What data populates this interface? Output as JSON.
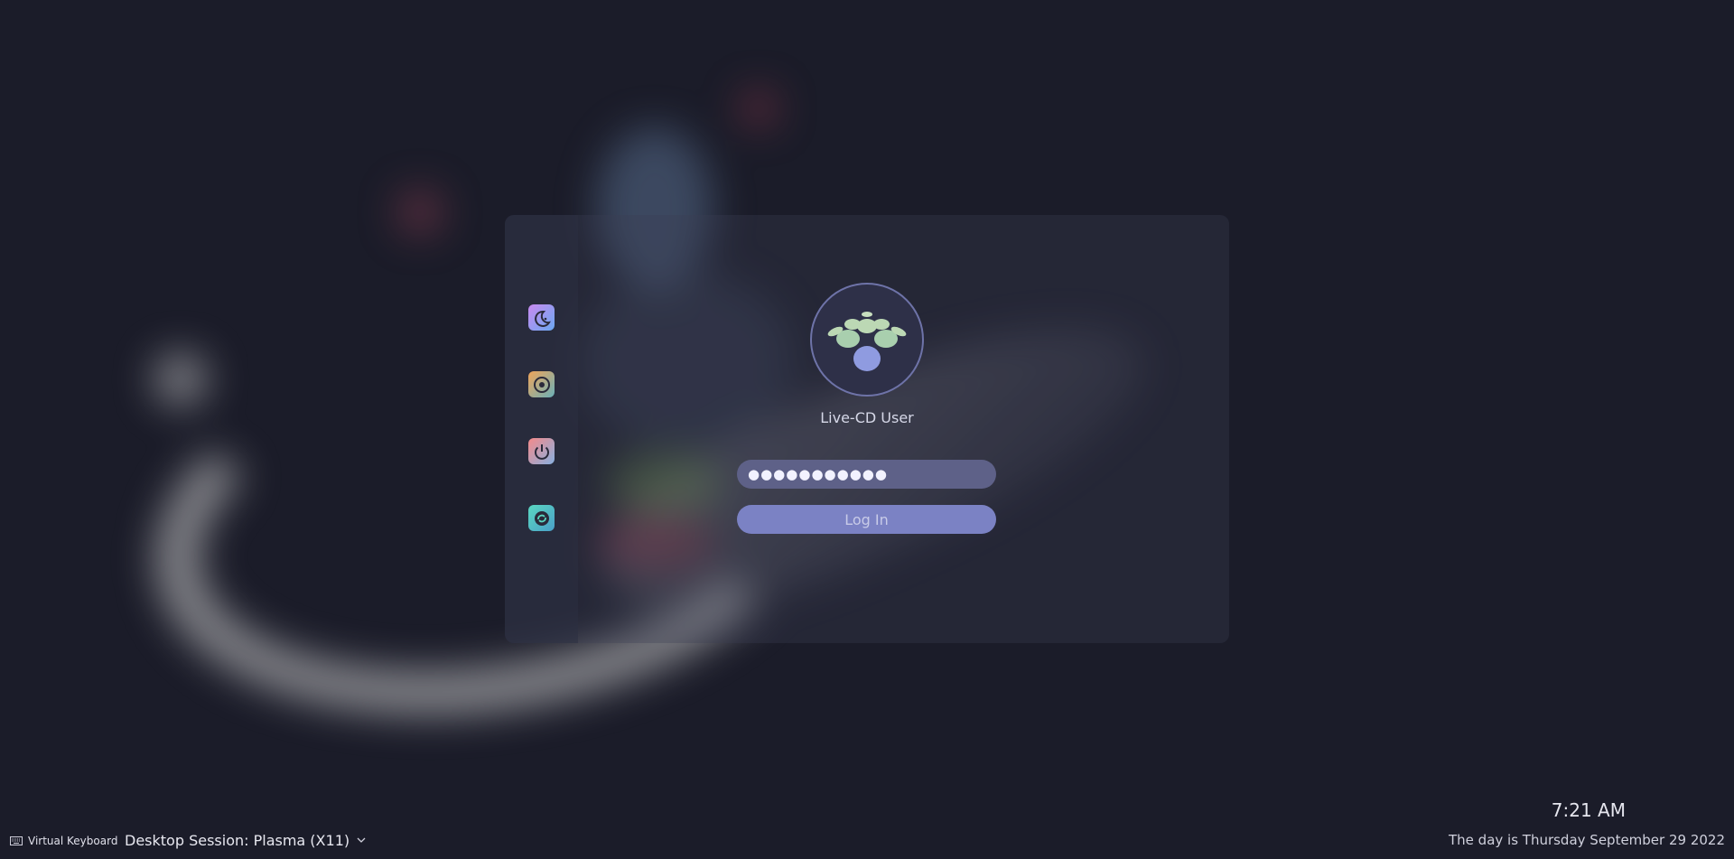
{
  "user": {
    "name": "Live-CD User",
    "password_dots": "●●●●●●●●●●●"
  },
  "actions": {
    "login_label": "Log In",
    "side_buttons": [
      {
        "icon": "sleep-icon"
      },
      {
        "icon": "hibernate-icon"
      },
      {
        "icon": "shutdown-icon"
      },
      {
        "icon": "restart-icon"
      }
    ]
  },
  "footer": {
    "virtual_keyboard_label": "Virtual Keyboard",
    "session_label": "Desktop Session: Plasma (X11)",
    "time": "7:21 AM",
    "date": "The day is Thursday September 29 2022"
  },
  "colors": {
    "background": "#1b1c29",
    "accent": "#7b82c4",
    "field": "#5e6188"
  }
}
